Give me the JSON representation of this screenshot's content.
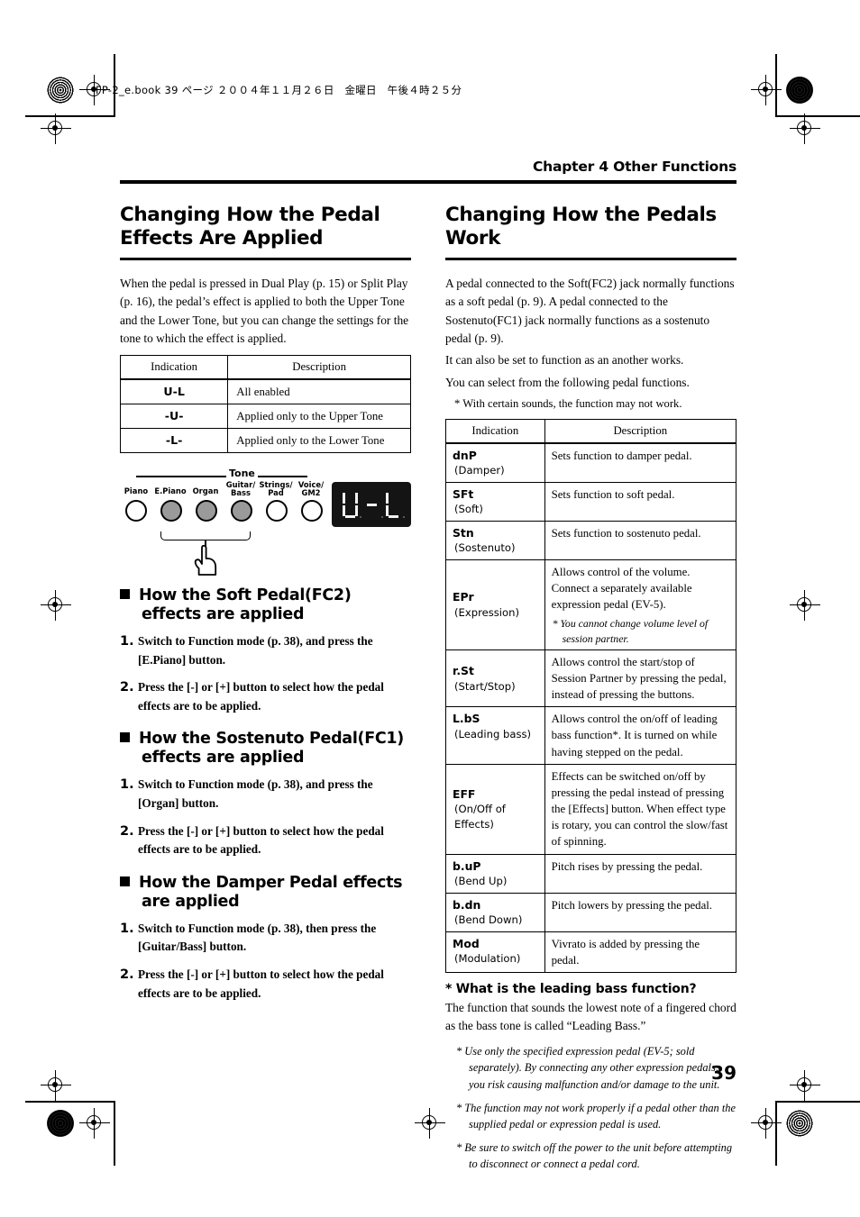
{
  "print_slug": "FP-2_e.book  39 ページ  ２００４年１１月２６日　金曜日　午後４時２５分",
  "chapter_header": "Chapter 4 Other Functions",
  "page_number": "39",
  "left": {
    "title": "Changing How the Pedal Effects Are Applied",
    "intro": "When the pedal is pressed in Dual Play (p. 15) or Split Play (p. 16), the pedal’s effect is applied to both the Upper Tone and the Lower Tone, but you can change the settings for the tone to which the effect is applied.",
    "table": {
      "headers": [
        "Indication",
        "Description"
      ],
      "rows": [
        {
          "indication": "U-L",
          "description": "All enabled"
        },
        {
          "indication": "-U-",
          "description": "Applied only to the Upper Tone"
        },
        {
          "indication": "-L-",
          "description": "Applied only to the Lower Tone"
        }
      ]
    },
    "figure": {
      "group_label": "Tone",
      "buttons": [
        {
          "label": "Piano",
          "lit": false
        },
        {
          "label": "E.Piano",
          "lit": true
        },
        {
          "label": "Organ",
          "lit": true
        },
        {
          "label": "Guitar/ Bass",
          "lit": true
        },
        {
          "label": "Strings/ Pad",
          "lit": false
        },
        {
          "label": "Voice/ GM2",
          "lit": false
        }
      ],
      "display_value": "U-L"
    },
    "sections": [
      {
        "heading": "How the Soft Pedal(FC2) effects are applied",
        "steps": [
          {
            "num": "1.",
            "text": "Switch to Function mode (p. 38), and press the [E.Piano] button."
          },
          {
            "num": "2.",
            "text": "Press the [-] or [+] button to select how the pedal effects are to be applied."
          }
        ]
      },
      {
        "heading": "How the Sostenuto Pedal(FC1) effects are applied",
        "steps": [
          {
            "num": "1.",
            "text": "Switch to Function mode (p. 38), and press the [Organ] button."
          },
          {
            "num": "2.",
            "text": "Press the [-] or [+] button to select how the pedal effects are to be applied."
          }
        ]
      },
      {
        "heading": "How the Damper Pedal effects are applied",
        "steps": [
          {
            "num": "1.",
            "text": "Switch to Function mode (p. 38), then press the [Guitar/Bass] button."
          },
          {
            "num": "2.",
            "text": "Press the [-] or [+] button to select how the pedal effects are to be applied."
          }
        ]
      }
    ]
  },
  "right": {
    "title": "Changing How the Pedals Work",
    "paragraphs": [
      "A pedal connected to the Soft(FC2) jack normally functions as a soft pedal (p. 9). A pedal connected to the Sostenuto(FC1) jack normally functions as a sostenuto pedal (p. 9).",
      "It can also be set to function as an another works.",
      "You can select from the following pedal functions."
    ],
    "note": "*   With certain sounds, the function may not work.",
    "table": {
      "headers": [
        "Indication",
        "Description"
      ],
      "rows": [
        {
          "code": "dnP",
          "name": "(Damper)",
          "description": "Sets function to damper pedal.",
          "sub": ""
        },
        {
          "code": "SFt",
          "name": "(Soft)",
          "description": "Sets function to soft pedal.",
          "sub": ""
        },
        {
          "code": "Stn",
          "name": " (Sostenuto)",
          "description": "Sets function to sostenuto pedal.",
          "sub": ""
        },
        {
          "code": "EPr",
          "name": " (Expression)",
          "description": "Allows control of the volume. Connect a separately available expression pedal (EV-5).",
          "sub": "*  You cannot change volume level of session partner."
        },
        {
          "code": "r.St",
          "name": " (Start/Stop)",
          "description": "Allows control the start/stop of Session Partner by pressing the pedal, instead of pressing the buttons.",
          "sub": ""
        },
        {
          "code": "L.bS",
          "name": "(Leading bass)",
          "description": "Allows control the on/off of leading bass function*. It is turned on while having stepped on the pedal.",
          "sub": ""
        },
        {
          "code": "EFF",
          "name": "(On/Off of Effects)",
          "description": "Effects can be switched on/off by pressing the pedal instead of pressing the [Effects] button. When effect type is rotary, you can control the slow/fast of spinning.",
          "sub": ""
        },
        {
          "code": "b.uP",
          "name": "(Bend Up)",
          "description": "Pitch rises by pressing the pedal.",
          "sub": ""
        },
        {
          "code": "b.dn",
          "name": "(Bend Down)",
          "description": "Pitch lowers by pressing the pedal.",
          "sub": ""
        },
        {
          "code": "Mod",
          "name": "(Modulation)",
          "description": "Vivrato is added by pressing the pedal.",
          "sub": ""
        }
      ]
    },
    "leading_bass": {
      "heading": "* What is the leading bass function?",
      "body": "The function that sounds the lowest note of a fingered chord as the bass tone is called “Leading Bass.”"
    },
    "footnotes": [
      "*    Use only the specified expression pedal (EV-5; sold separately). By connecting any other expression pedals, you risk causing malfunction and/or damage to the unit.",
      "*    The function may not work properly if a pedal other than the supplied pedal or expression pedal is used.",
      "*    Be sure to switch off the power to the unit before attempting to disconnect or connect a pedal cord."
    ]
  }
}
